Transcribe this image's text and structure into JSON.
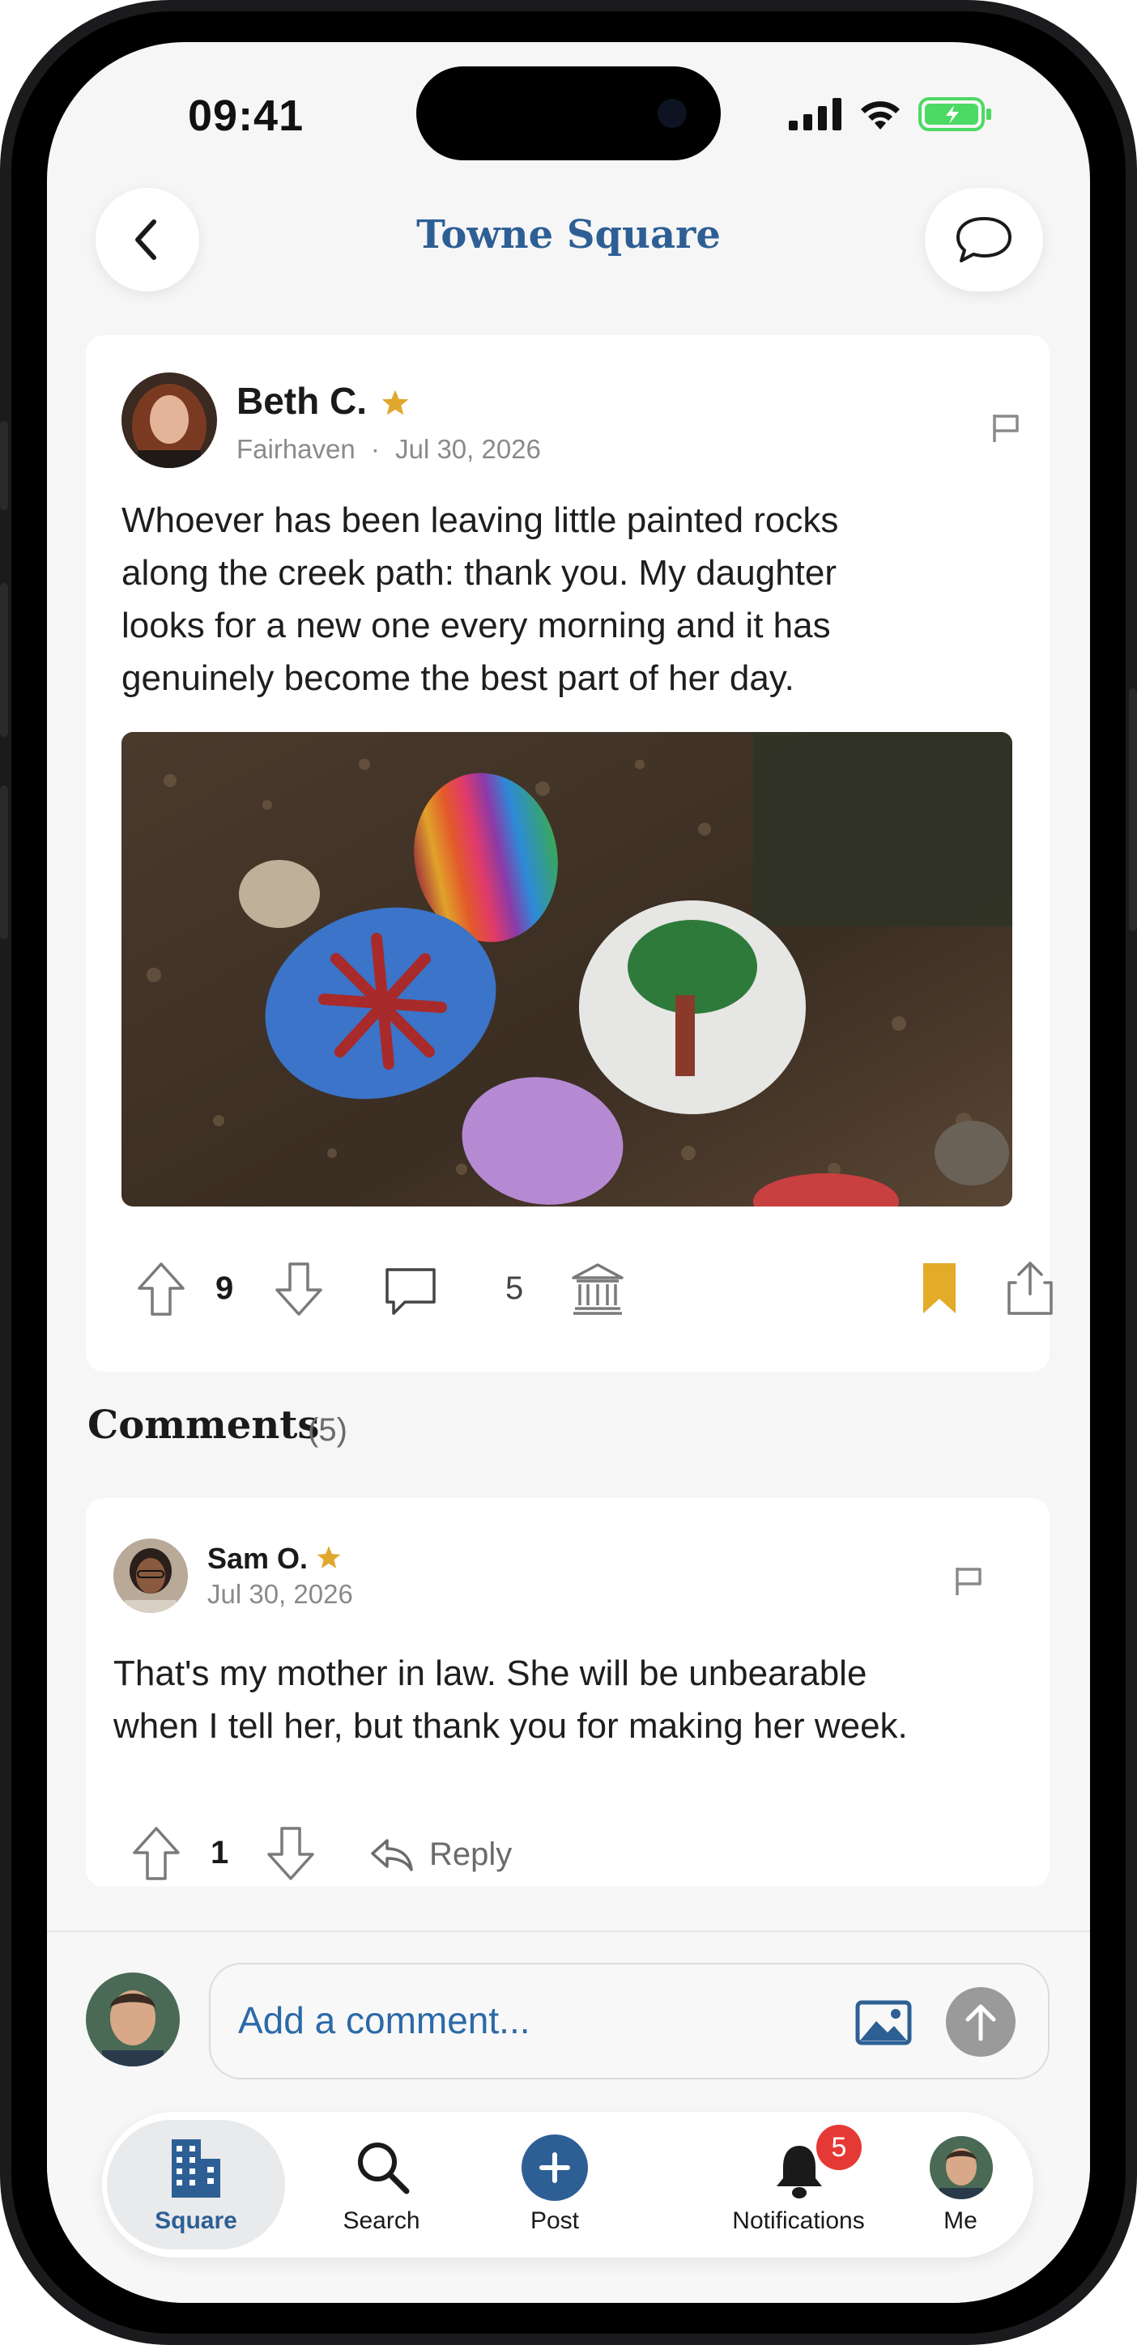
{
  "status": {
    "time": "09:41"
  },
  "header": {
    "title": "Towne Square"
  },
  "post": {
    "author": "Beth C.",
    "location": "Fairhaven",
    "date": "Jul 30, 2026",
    "meta_sep": "·",
    "body_lines": [
      "Whoever has been leaving little painted rocks",
      "along the creek path: thank you. My daughter",
      "looks for a new one every morning and it has",
      "genuinely become the best part of her day."
    ],
    "upvotes": "9",
    "comments": "5"
  },
  "comments_section": {
    "title": "Comments",
    "count": "(5)"
  },
  "comment": {
    "author": "Sam O.",
    "date": "Jul 30, 2026",
    "body_lines": [
      "That's my mother in law. She will be unbearable",
      "when I tell her, but thank you for making her week."
    ],
    "upvotes": "1",
    "reply_label": "Reply"
  },
  "composer": {
    "placeholder": "Add a comment..."
  },
  "tabs": [
    {
      "label": "Square"
    },
    {
      "label": "Search"
    },
    {
      "label": "Post"
    },
    {
      "label": "Notifications",
      "badge": "5"
    },
    {
      "label": "Me"
    }
  ],
  "colors": {
    "brand": "#2d5f95",
    "accent_star": "#e0a82e",
    "bookmark": "#e2ab28",
    "badge": "#e53935",
    "battery": "#4cd964"
  }
}
